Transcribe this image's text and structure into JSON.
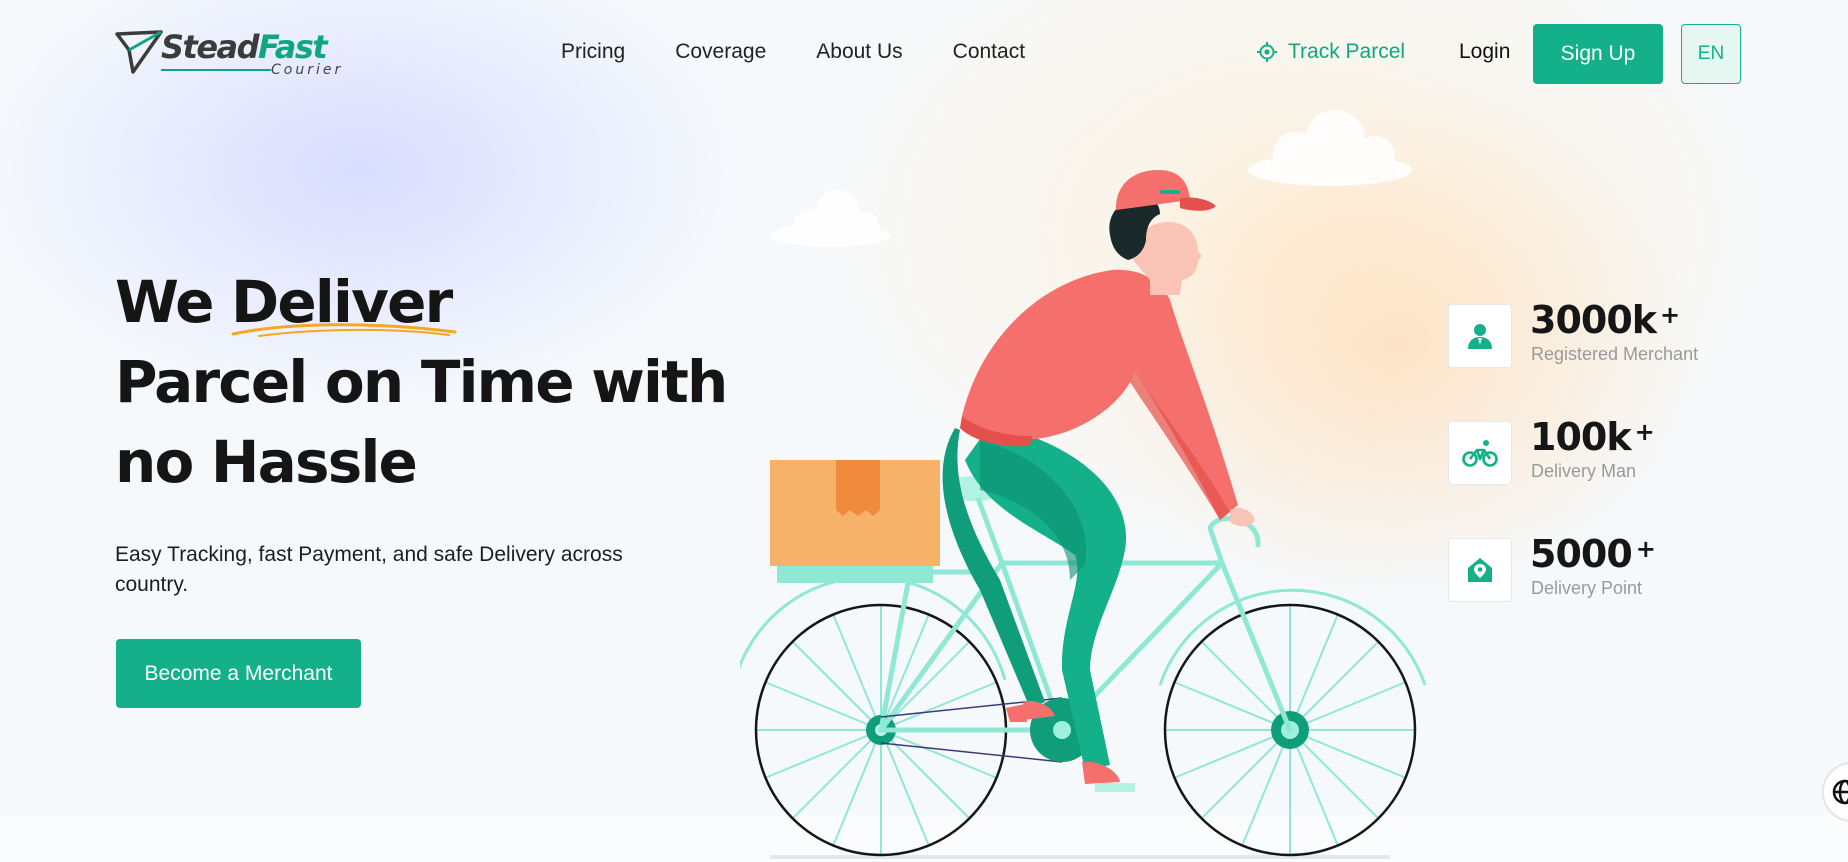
{
  "logo": {
    "part1": "Stead",
    "part2": "Fast",
    "sub": "Courier"
  },
  "nav": {
    "items": [
      {
        "label": "Pricing"
      },
      {
        "label": "Coverage"
      },
      {
        "label": "About Us"
      },
      {
        "label": "Contact"
      }
    ]
  },
  "header": {
    "track_label": "Track Parcel",
    "track_icon": "target-icon",
    "login_label": "Login",
    "signup_label": "Sign Up",
    "language": "EN"
  },
  "hero": {
    "title_prefix": "We ",
    "title_highlight": "Deliver",
    "title_rest": "Parcel on Time with no Hassle",
    "description": "Easy Tracking, fast Payment, and safe Delivery across country.",
    "cta_label": "Become a Merchant"
  },
  "stats": [
    {
      "value": "3000k",
      "suffix": "+",
      "label": "Registered Merchant",
      "icon": "merchant-icon"
    },
    {
      "value": "100k",
      "suffix": "+",
      "label": "Delivery Man",
      "icon": "bicycle-icon"
    },
    {
      "value": "5000",
      "suffix": "+",
      "label": "Delivery Point",
      "icon": "location-house-icon"
    }
  ],
  "colors": {
    "brand": "#13b08a",
    "highlight_underline": "#f5a623",
    "rider_shirt": "#f5706c",
    "rider_pants": "#13b08a",
    "box": "#f7b26a"
  }
}
